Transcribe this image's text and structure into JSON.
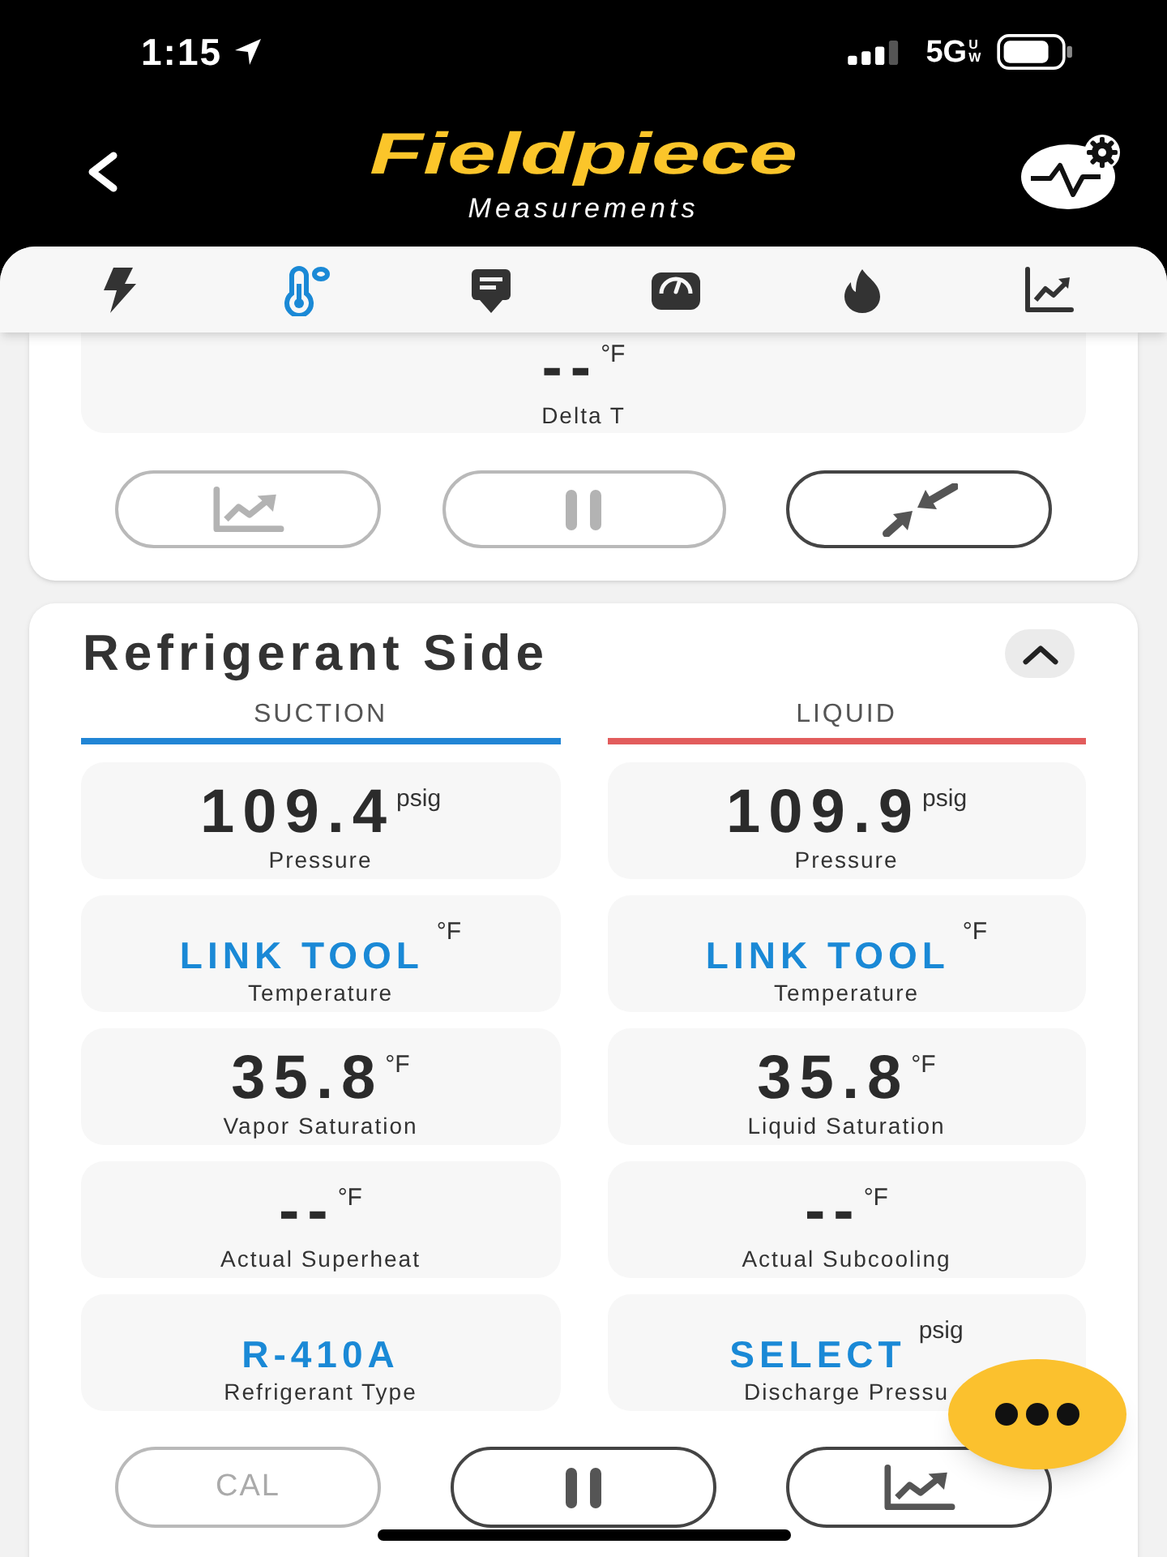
{
  "status_bar": {
    "time": "1:15",
    "network": "5G",
    "network_suffix": "UW"
  },
  "header": {
    "logo": "Fieldpiece",
    "subtitle": "Measurements"
  },
  "tabs": [
    {
      "selected": false
    },
    {
      "selected": true
    },
    {
      "selected": false
    },
    {
      "selected": false
    },
    {
      "selected": false
    },
    {
      "selected": false
    }
  ],
  "airflow_card": {
    "tiles": [
      {
        "kind": "reading",
        "value": "--",
        "unit": "°F",
        "label": "Delta T"
      }
    ],
    "buttons": [
      {
        "kind": "graph",
        "disabled": true
      },
      {
        "kind": "pause",
        "disabled": true
      },
      {
        "kind": "compress",
        "disabled": false
      }
    ]
  },
  "refrigerant_card": {
    "title": "Refrigerant Side",
    "expanded": true,
    "columns": [
      {
        "heading": "SUCTION",
        "color": "#2185d5",
        "tiles": [
          {
            "kind": "reading",
            "value": "109.4",
            "unit": "psig",
            "label": "Pressure"
          },
          {
            "kind": "action",
            "value": "LINK TOOL",
            "unit": "°F",
            "label": "Temperature"
          },
          {
            "kind": "reading",
            "value": "35.8",
            "unit": "°F",
            "label": "Vapor Saturation"
          },
          {
            "kind": "reading",
            "value": "--",
            "unit": "°F",
            "label": "Actual Superheat"
          },
          {
            "kind": "action",
            "value": "R-410A",
            "label": "Refrigerant Type"
          }
        ]
      },
      {
        "heading": "LIQUID",
        "color": "#e25c5c",
        "tiles": [
          {
            "kind": "reading",
            "value": "109.9",
            "unit": "psig",
            "label": "Pressure"
          },
          {
            "kind": "action",
            "value": "LINK TOOL",
            "unit": "°F",
            "label": "Temperature"
          },
          {
            "kind": "reading",
            "value": "35.8",
            "unit": "°F",
            "label": "Liquid Saturation"
          },
          {
            "kind": "reading",
            "value": "--",
            "unit": "°F",
            "label": "Actual Subcooling"
          },
          {
            "kind": "action",
            "value": "SELECT",
            "unit": "psig",
            "label": "Discharge Pressu"
          }
        ]
      }
    ],
    "buttons": [
      {
        "kind": "calibrate",
        "label": "CAL",
        "disabled": true
      },
      {
        "kind": "pause",
        "disabled": false
      },
      {
        "kind": "graph",
        "disabled": false
      }
    ]
  }
}
